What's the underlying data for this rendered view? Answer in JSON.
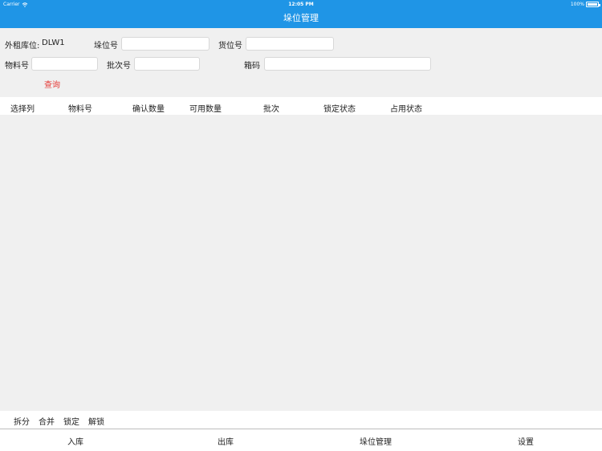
{
  "status_bar": {
    "carrier": "Carrier",
    "time": "12:05 PM",
    "battery": "100%"
  },
  "nav": {
    "title": "垛位管理"
  },
  "form": {
    "warehouse_label": "外租库位:",
    "warehouse_value": "DLW1",
    "stack_label": "垛位号",
    "stack_value": "",
    "cargo_label": "货位号",
    "cargo_value": "",
    "material_label": "物料号",
    "material_value": "",
    "batch_label": "批次号",
    "batch_value": "",
    "box_label": "箱码",
    "box_value": "",
    "query_label": "查询"
  },
  "table": {
    "columns": [
      "选择列",
      "物料号",
      "确认数量",
      "可用数量",
      "批次",
      "锁定状态",
      "占用状态"
    ],
    "rows": []
  },
  "actions": {
    "split": "拆分",
    "merge": "合并",
    "lock": "锁定",
    "unlock": "解锁"
  },
  "tabs": [
    "入库",
    "出库",
    "垛位管理",
    "设置"
  ],
  "colors": {
    "nav_blue": "#1f95e6",
    "query_red": "#e53935",
    "background": "#f0f0f0"
  }
}
